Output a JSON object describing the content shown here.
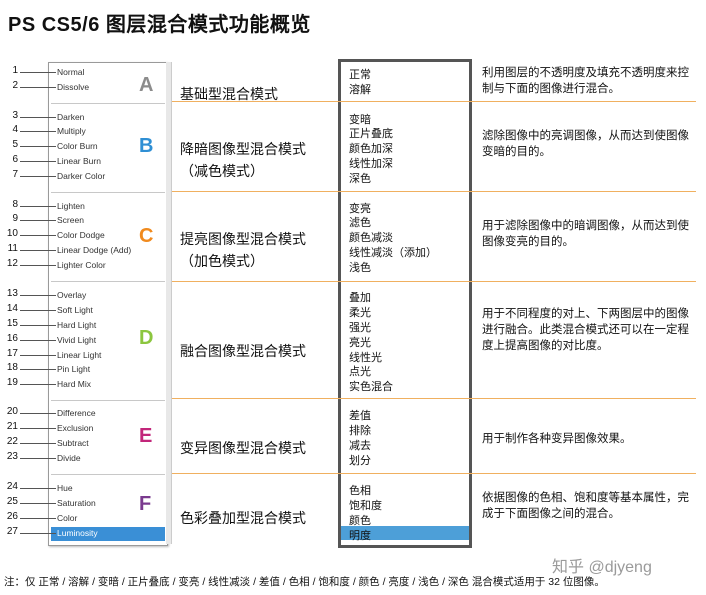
{
  "title": "PS CS5/6 图层混合模式功能概览",
  "colors": {
    "A": "#8c8c8c",
    "B": "#2f8fd4",
    "C": "#f08a1e",
    "D": "#8cc63f",
    "E": "#c2267a",
    "F": "#7a3a8e",
    "separator": "#f0b060",
    "highlight": "#3a8fd6"
  },
  "menu": [
    {
      "n": "1",
      "label": "Normal"
    },
    {
      "n": "2",
      "label": "Dissolve"
    },
    {
      "n": "3",
      "label": "Darken"
    },
    {
      "n": "4",
      "label": "Multiply"
    },
    {
      "n": "5",
      "label": "Color Burn"
    },
    {
      "n": "6",
      "label": "Linear Burn"
    },
    {
      "n": "7",
      "label": "Darker Color"
    },
    {
      "n": "8",
      "label": "Lighten"
    },
    {
      "n": "9",
      "label": "Screen"
    },
    {
      "n": "10",
      "label": "Color Dodge"
    },
    {
      "n": "11",
      "label": "Linear Dodge (Add)"
    },
    {
      "n": "12",
      "label": "Lighter Color"
    },
    {
      "n": "13",
      "label": "Overlay"
    },
    {
      "n": "14",
      "label": "Soft Light"
    },
    {
      "n": "15",
      "label": "Hard Light"
    },
    {
      "n": "16",
      "label": "Vivid Light"
    },
    {
      "n": "17",
      "label": "Linear Light"
    },
    {
      "n": "18",
      "label": "Pin Light"
    },
    {
      "n": "19",
      "label": "Hard Mix"
    },
    {
      "n": "20",
      "label": "Difference"
    },
    {
      "n": "21",
      "label": "Exclusion"
    },
    {
      "n": "22",
      "label": "Subtract"
    },
    {
      "n": "23",
      "label": "Divide"
    },
    {
      "n": "24",
      "label": "Hue"
    },
    {
      "n": "25",
      "label": "Saturation"
    },
    {
      "n": "26",
      "label": "Color"
    },
    {
      "n": "27",
      "label": "Luminosity"
    }
  ],
  "groups": [
    {
      "letter": "A",
      "name": "基础型混合模式",
      "sub": "",
      "modes": [
        "正常",
        "溶解"
      ],
      "desc": "利用图层的不透明度及填充不透明度来控制与下面的图像进行混合。"
    },
    {
      "letter": "B",
      "name": "降暗图像型混合模式",
      "sub": "（减色模式）",
      "modes": [
        "变暗",
        "正片叠底",
        "颜色加深",
        "线性加深",
        "深色"
      ],
      "desc": "滤除图像中的亮调图像，从而达到使图像变暗的目的。"
    },
    {
      "letter": "C",
      "name": "提亮图像型混合模式",
      "sub": "（加色模式）",
      "modes": [
        "变亮",
        "滤色",
        "颜色减淡",
        "线性减淡（添加）",
        "浅色"
      ],
      "desc": "用于滤除图像中的暗调图像，从而达到使图像变亮的目的。"
    },
    {
      "letter": "D",
      "name": "融合图像型混合模式",
      "sub": "",
      "modes": [
        "叠加",
        "柔光",
        "强光",
        "亮光",
        "线性光",
        "点光",
        "实色混合"
      ],
      "desc": "用于不同程度的对上、下两图层中的图像进行融合。此类混合模式还可以在一定程度上提高图像的对比度。"
    },
    {
      "letter": "E",
      "name": "变异图像型混合模式",
      "sub": "",
      "modes": [
        "差值",
        "排除",
        "减去",
        "划分"
      ],
      "desc": "用于制作各种变异图像效果。"
    },
    {
      "letter": "F",
      "name": "色彩叠加型混合模式",
      "sub": "",
      "modes": [
        "色相",
        "饱和度",
        "颜色",
        "明度"
      ],
      "desc": "依据图像的色相、饱和度等基本属性，完成于下面图像之间的混合。"
    }
  ],
  "watermark": "知乎 @djyeng",
  "note": "注：仅 正常 / 溶解 / 变暗 / 正片叠底 / 变亮 / 线性减淡 / 差值 / 色相 / 饱和度 / 颜色 / 亮度 / 浅色 / 深色 混合模式适用于 32 位图像。"
}
